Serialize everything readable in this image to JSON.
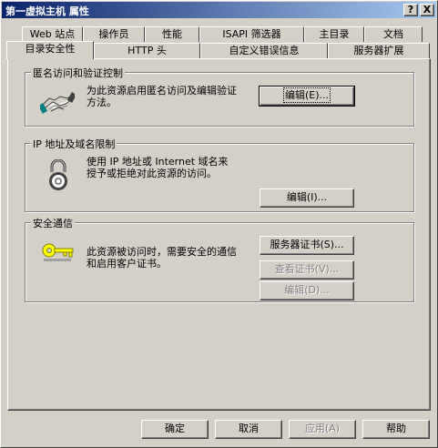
{
  "title": "第一虚拟主机 属性",
  "title_buttons": {
    "help": "?",
    "close": "X"
  },
  "tabs_row1": [
    "Web 站点",
    "操作员",
    "性能",
    "ISAPI 筛选器",
    "主目录",
    "文档"
  ],
  "tabs_row2": [
    "目录安全性",
    "HTTP 头",
    "自定义错误信息",
    "服务器扩展"
  ],
  "groups": {
    "anonymous": {
      "legend": "匿名访问和验证控制",
      "desc": "为此资源启用匿名访问及编辑验证\n方法。",
      "edit_button": "编辑(E)..."
    },
    "ip": {
      "legend": "IP 地址及域名限制",
      "desc": "使用 IP 地址或 Internet 域名来\n授予或拒绝对此资源的访问。",
      "edit_button": "编辑(I)..."
    },
    "secure": {
      "legend": "安全通信",
      "desc": "此资源被访问时，需要安全的通信\n和启用客户证书。",
      "server_cert_button": "服务器证书(S)...",
      "view_cert_button": "查看证书(V)...",
      "edit_button": "编辑(D)..."
    }
  },
  "bottom_buttons": {
    "ok": "确定",
    "cancel": "取消",
    "apply": "应用(A)",
    "help": "帮助"
  }
}
